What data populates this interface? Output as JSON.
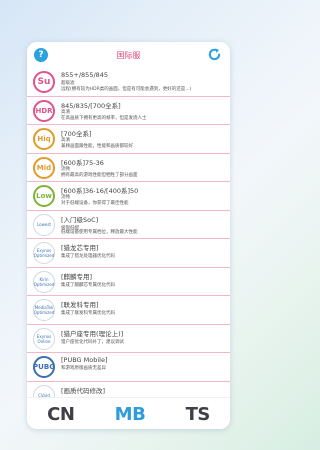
{
  "header": {
    "help_label": "?",
    "title": "国际服",
    "refresh_icon": "refresh-icon"
  },
  "items": [
    {
      "badge": "Su",
      "badge_color": "#e0538a",
      "line1": "855+/855/845",
      "line2": "超级滤",
      "line3": "远程(拥有较为HDR类的画面，但是有可能会遇到，更好的还是...)"
    },
    {
      "badge": "HDR",
      "badge_color": "#e0538a",
      "line1": "845/835/[700全系]",
      "line2": "高清",
      "line3": "在高画质下拥有更高的帧率，但是发烧人士"
    },
    {
      "badge": "Hiq",
      "badge_color": "#e39a2d",
      "line1": "[700全系]",
      "line2": "高清",
      "line3": "兼顾画面跟性能，性能和画质都较好"
    },
    {
      "badge": "Mid",
      "badge_color": "#e39a2d",
      "line1": "[600系]75-36",
      "line2": "流畅",
      "line3": "拥有最高的游戏性能但牺牲了部分画面"
    },
    {
      "badge": "Low",
      "badge_color": "#7fb33a",
      "line1": "[600系]36-16/[400系]50",
      "line2": "流畅",
      "line3": "对于低端设备，你获得了最佳性能"
    },
    {
      "badge": "Lowest",
      "badge_color": "#7fb33a",
      "line1": "[入门级SoC]",
      "line2": "极限低配",
      "line3": "低端设备使用专属档位，释放最大性能"
    },
    {
      "badge": "Exynos Optimized",
      "badge_color": "#3b6fb5",
      "line1": "[猎龙芯专用]",
      "line2": "集成了猎龙处理器优化代码",
      "line3": ""
    },
    {
      "badge": "Kirin Optimized",
      "badge_color": "#3b6fb5",
      "line1": "[麒麟专用]",
      "line2": "集成了麒麟芯专属优化代码",
      "line3": ""
    },
    {
      "badge": "MediaTek Optimized",
      "badge_color": "#3b6fb5",
      "line1": "[联发科专用]",
      "line2": "集成了联发科专属优化代码",
      "line3": ""
    },
    {
      "badge": "Exynos Online",
      "badge_color": "#3b6fb5",
      "line1": "[猎户座专用(理论上)]",
      "line2": "猎户座优化代码补丁，建议调试",
      "line3": ""
    },
    {
      "badge": "PUBG",
      "badge_color": "#3b6fb5",
      "line1": "[PUBG Mobile]",
      "line2": "和游戏原版画质无差异",
      "line3": ""
    },
    {
      "badge": "CVard",
      "badge_color": "#555555",
      "line1": "[画质代码修改]",
      "line2": "",
      "line3": ""
    }
  ],
  "tabs": [
    {
      "label": "CN",
      "active": false
    },
    {
      "label": "MB",
      "active": true
    },
    {
      "label": "TS",
      "active": false
    }
  ]
}
